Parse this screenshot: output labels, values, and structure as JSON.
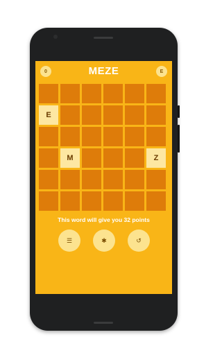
{
  "game": {
    "title": "MEZE",
    "score_left": "0",
    "badge_right": "E",
    "grid": [
      [
        "",
        "",
        "",
        "",
        "",
        ""
      ],
      [
        "E",
        "",
        "",
        "",
        "",
        ""
      ],
      [
        "",
        "",
        "",
        "",
        "",
        ""
      ],
      [
        "",
        "M",
        "",
        "",
        "",
        "Z"
      ],
      [
        "",
        "",
        "",
        "",
        "",
        ""
      ],
      [
        "",
        "",
        "",
        "",
        "",
        ""
      ]
    ],
    "message": "This word will give you 32 points",
    "actions": [
      {
        "name": "list-icon",
        "glyph": "☰"
      },
      {
        "name": "star-icon",
        "glyph": "✱"
      },
      {
        "name": "undo-icon",
        "glyph": "↺"
      }
    ]
  },
  "colors": {
    "background": "#f9b517",
    "tile": "#de7c0a",
    "tile_lit": "#fde7a2",
    "button": "#fce38f"
  }
}
